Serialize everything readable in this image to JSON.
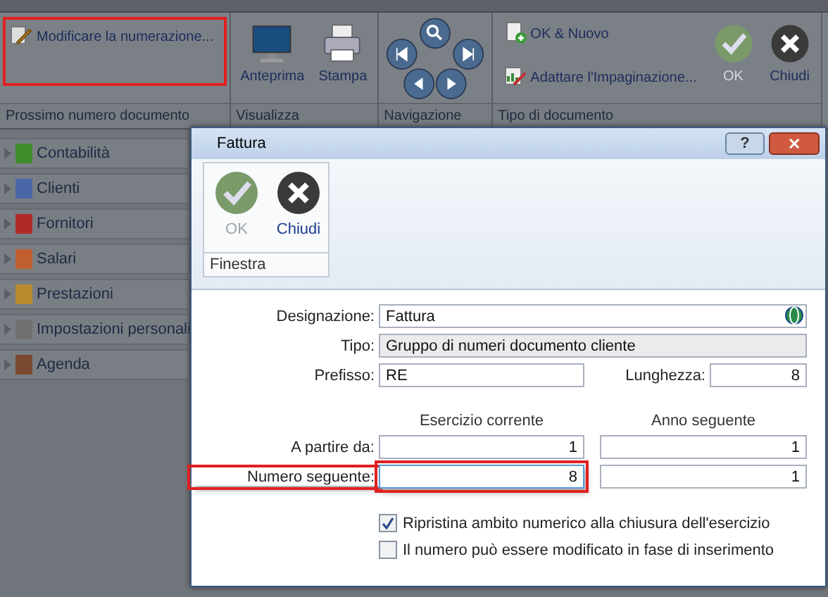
{
  "ribbon": {
    "groups": [
      {
        "label": "Prossimo numero documento",
        "annotated": true,
        "items": [
          {
            "label": "Modificare la numerazione...",
            "kind": "edit",
            "disabled": false
          }
        ]
      },
      {
        "label": "Visualizza",
        "annotated": false,
        "items": [
          {
            "label": "Anteprima",
            "kind": "monitor",
            "disabled": false
          },
          {
            "label": "Stampa",
            "kind": "printer",
            "disabled": false
          }
        ]
      },
      {
        "label": "Navigazione",
        "annotated": false,
        "items": [
          {
            "kind": "nav"
          }
        ]
      },
      {
        "label": "Tipo di documento",
        "annotated": false,
        "items": [
          {
            "label": "OK & Nuovo",
            "kind": "add",
            "disabled": false
          },
          {
            "label": "Adattare l'Impaginazione...",
            "kind": "layout",
            "disabled": false
          },
          {
            "label": "OK",
            "kind": "ok",
            "disabled": true
          },
          {
            "label": "Chiudi",
            "kind": "close",
            "disabled": false
          }
        ]
      }
    ]
  },
  "sidebar": {
    "items": [
      {
        "label": "Contabilità",
        "color": "#3f8a2a"
      },
      {
        "label": "Clienti",
        "color": "#4a68a8"
      },
      {
        "label": "Fornitori",
        "color": "#b02a2a"
      },
      {
        "label": "Salari",
        "color": "#c06030"
      },
      {
        "label": "Prestazioni",
        "color": "#b88a30"
      },
      {
        "label": "Impostazioni personali",
        "color": "#707070"
      },
      {
        "label": "Agenda",
        "color": "#7a4a30"
      }
    ]
  },
  "dialog": {
    "title": "Fattura",
    "help_button": "?",
    "close_button": "✕",
    "toolbar": {
      "label": "Finestra",
      "buttons": [
        {
          "label": "OK",
          "kind": "ok",
          "disabled": true
        },
        {
          "label": "Chiudi",
          "kind": "close",
          "disabled": false
        }
      ]
    },
    "fields": {
      "designazione": {
        "label": "Designazione:",
        "value": "Fattura"
      },
      "tipo": {
        "label": "Tipo:",
        "value": "Gruppo di numeri documento cliente",
        "disabled": true
      },
      "prefisso": {
        "label": "Prefisso:",
        "value": "RE"
      },
      "lunghezza": {
        "label": "Lunghezza:",
        "value": "8"
      }
    },
    "columns": [
      "Esercizio corrente",
      "Anno seguente"
    ],
    "rows": [
      {
        "label": "A partire da:",
        "values": [
          "1",
          "1"
        ],
        "annotated": false,
        "focused": false
      },
      {
        "label": "Numero seguente:",
        "values": [
          "8",
          "1"
        ],
        "annotated": true,
        "focused": true
      }
    ],
    "checkboxes": [
      {
        "label": "Ripristina ambito numerico alla chiusura dell'esercizio",
        "checked": true
      },
      {
        "label": "Il numero può essere modificato in fase di inserimento",
        "checked": false
      }
    ]
  }
}
